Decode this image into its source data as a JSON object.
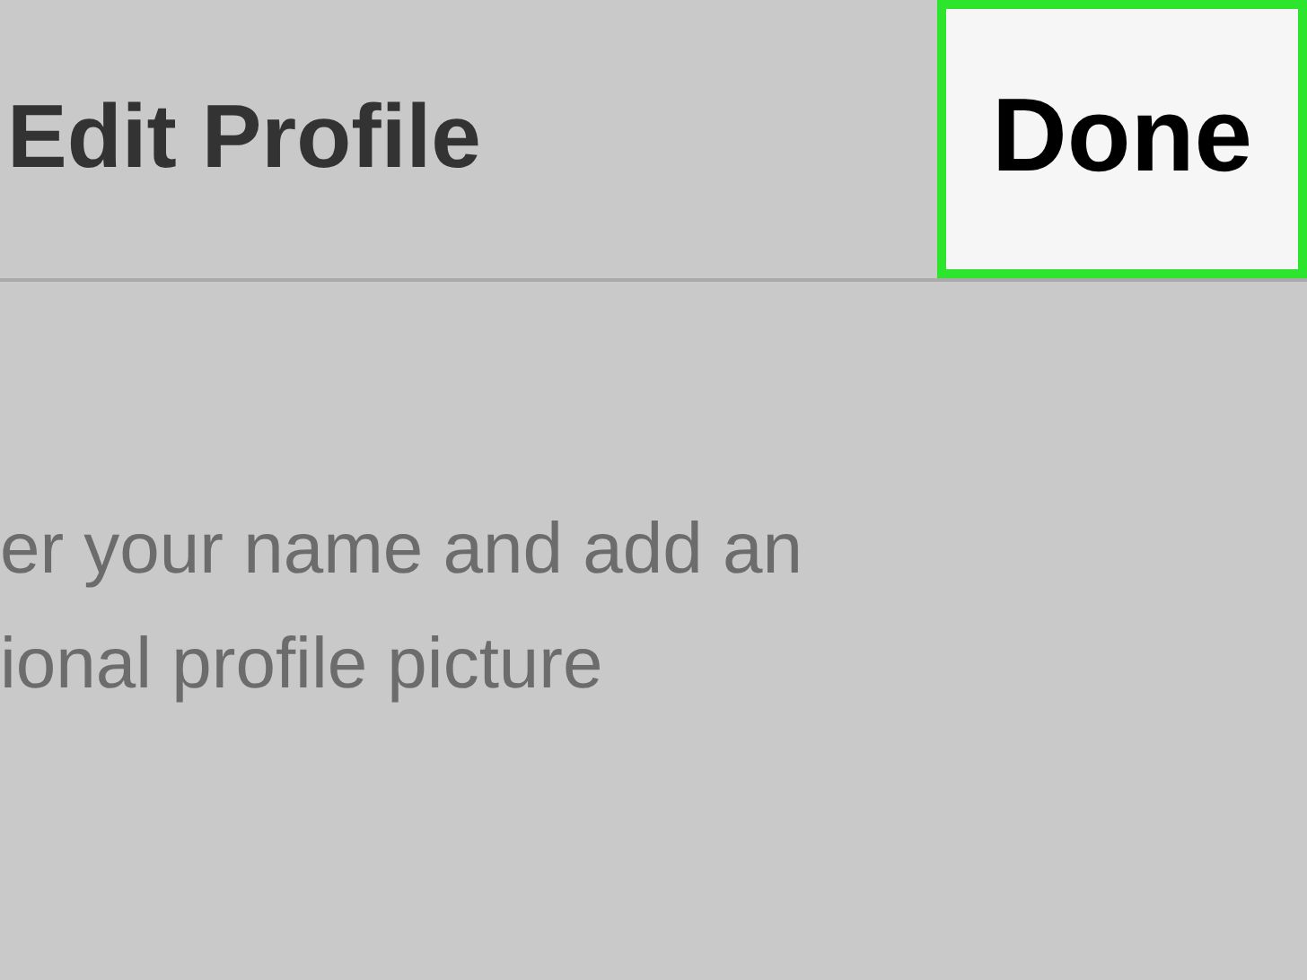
{
  "header": {
    "title": "Edit Profile",
    "done_button": {
      "label": "Done",
      "highlighted": true
    }
  },
  "description": [
    "er your name and add an",
    "ional profile picture"
  ]
}
